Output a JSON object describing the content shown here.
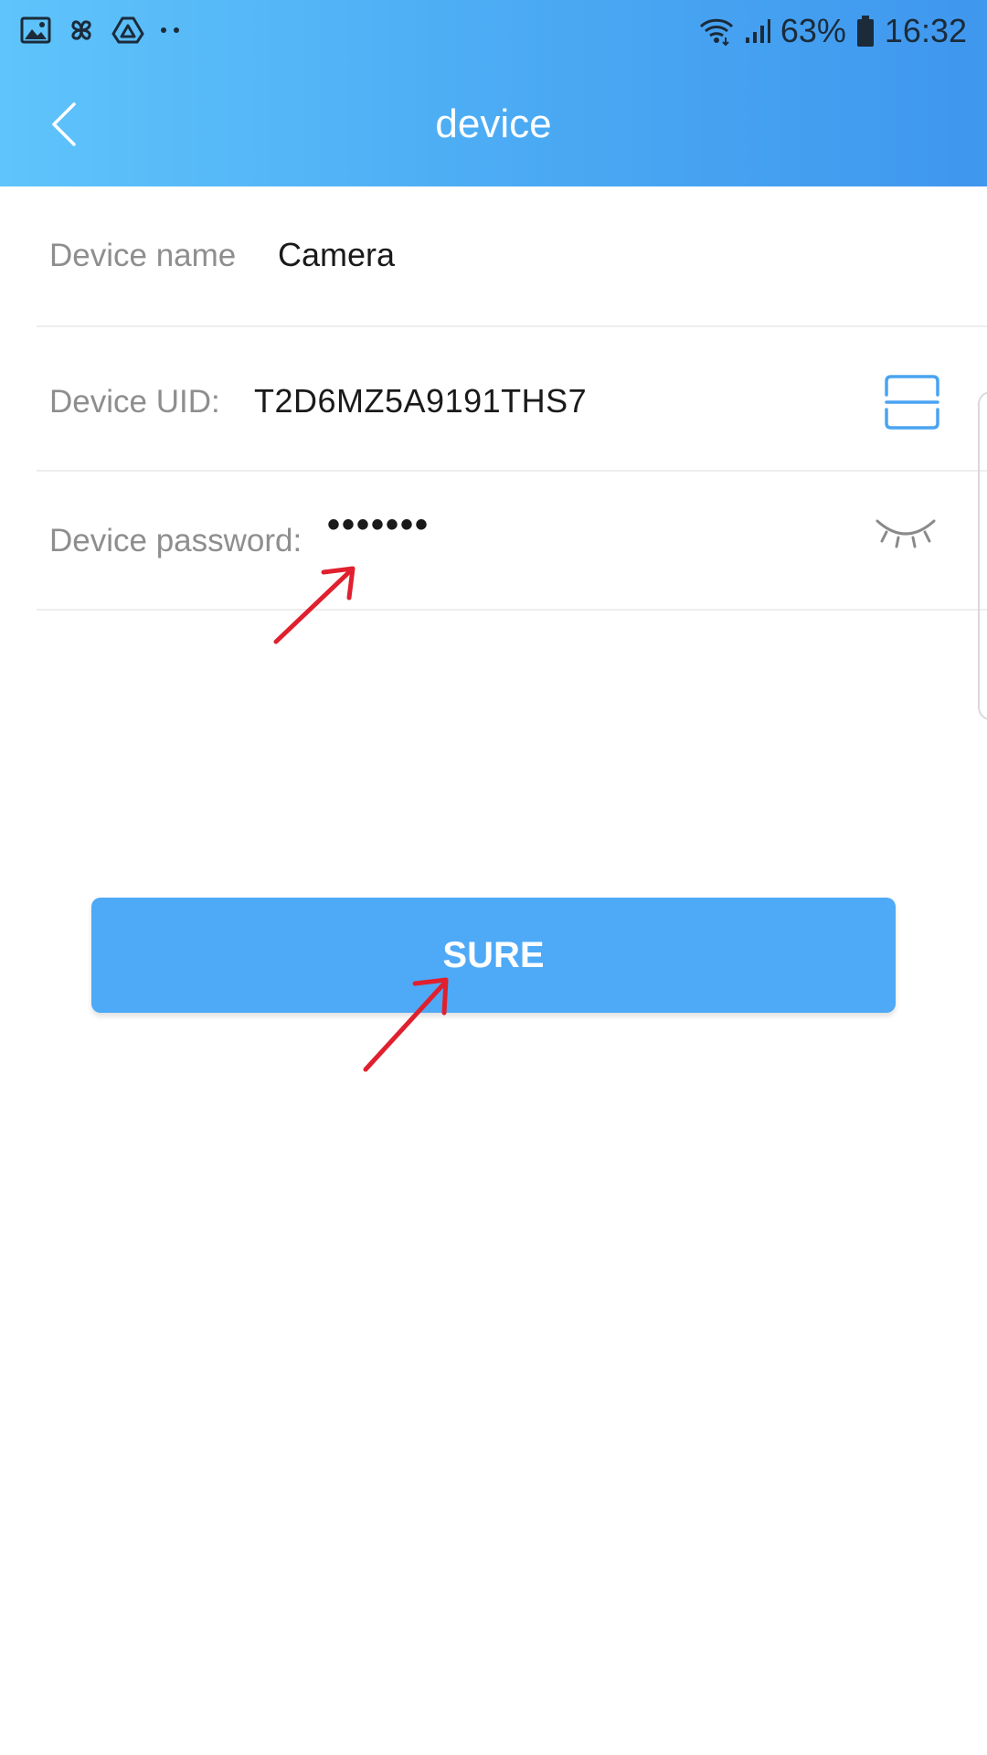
{
  "status_bar": {
    "battery": "63%",
    "time": "16:32",
    "left_icons": [
      "gallery-icon",
      "pinwheel-icon",
      "drive-icon",
      "more-dots-icon"
    ],
    "right_icons": [
      "wifi-icon",
      "signal-icon",
      "battery-icon"
    ]
  },
  "app_bar": {
    "title": "device",
    "back_icon": "chevron-left-icon"
  },
  "form": {
    "device_name": {
      "label": "Device name",
      "value": "Camera"
    },
    "device_uid": {
      "label": "Device UID:",
      "value": "T2D6MZ5A9191THS7",
      "action_icon": "scan-icon"
    },
    "device_password": {
      "label": "Device password:",
      "value": "•••••••",
      "action_icon": "eye-closed-icon"
    }
  },
  "actions": {
    "sure_label": "SURE"
  },
  "colors": {
    "header_gradient_start": "#5fc4fb",
    "header_gradient_end": "#3f97ee",
    "button": "#4ea9f7",
    "annotation_arrow": "#e0202e",
    "label_text": "#8e8e8e",
    "value_text": "#1a1a1a"
  }
}
